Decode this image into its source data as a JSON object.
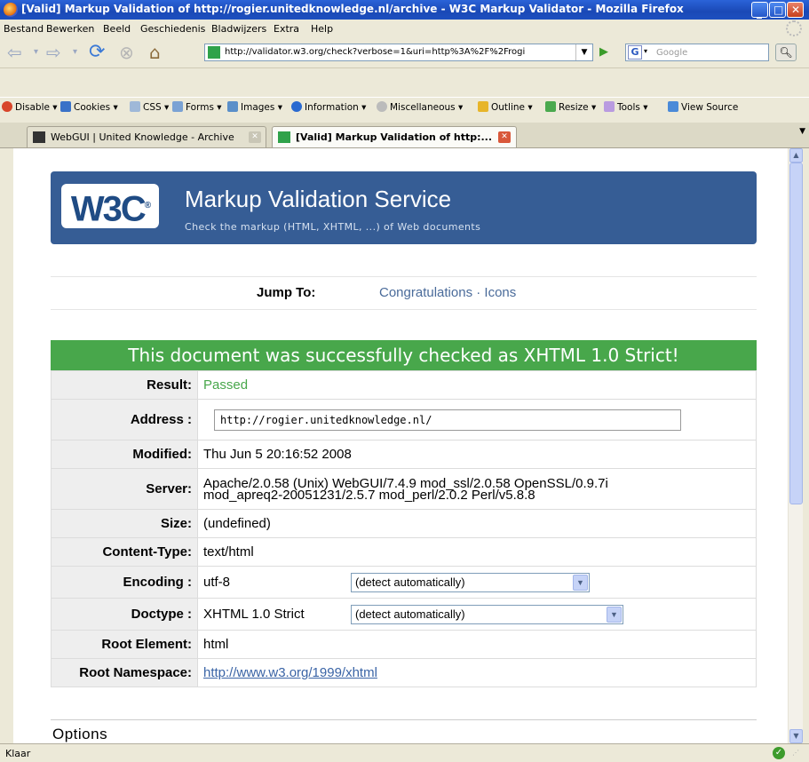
{
  "window": {
    "title": "[Valid] Markup Validation of http://rogier.unitedknowledge.nl/archive - W3C Markup Validator - Mozilla Firefox"
  },
  "menu": [
    "Bestand",
    "Bewerken",
    "Beeld",
    "Geschiedenis",
    "Bladwijzers",
    "Extra",
    "Help"
  ],
  "nav": {
    "url": "http://validator.w3.org/check?verbose=1&uri=http%3A%2F%2Frogi",
    "search_placeholder": "Google",
    "search_engine_glyph": "G"
  },
  "webdev": [
    "Disable",
    "Cookies",
    "CSS",
    "Forms",
    "Images",
    "Information",
    "Miscellaneous",
    "Outline",
    "Resize",
    "Tools",
    "View Source"
  ],
  "tabs": [
    {
      "label": "WebGUI | United Knowledge - Archive"
    },
    {
      "label": "[Valid] Markup Validation of http:..."
    }
  ],
  "page": {
    "logo_text": "W3C",
    "logo_reg": "®",
    "service_title": "Markup Validation Service",
    "service_subtitle": "Check the markup (HTML, XHTML, ...) of Web documents",
    "jump_label": "Jump To:",
    "jump_links": "Congratulations · Icons",
    "success_message": "This document was successfully checked as XHTML 1.0 Strict!",
    "rows": {
      "result": {
        "label": "Result:",
        "value": "Passed"
      },
      "address": {
        "label": "Address :",
        "value": "http://rogier.unitedknowledge.nl/"
      },
      "modified": {
        "label": "Modified:",
        "value": "Thu Jun 5 20:16:52 2008"
      },
      "server": {
        "label": "Server:",
        "value_line1": "Apache/2.0.58 (Unix) WebGUI/7.4.9 mod_ssl/2.0.58 OpenSSL/0.9.7i",
        "value_line2": "mod_apreq2-20051231/2.5.7 mod_perl/2.0.2 Perl/v5.8.8"
      },
      "size": {
        "label": "Size:",
        "value": "(undefined)"
      },
      "content_type": {
        "label": "Content-Type:",
        "value": "text/html"
      },
      "encoding": {
        "label": "Encoding :",
        "value": "utf-8",
        "select": "(detect automatically)"
      },
      "doctype": {
        "label": "Doctype :",
        "value": "XHTML 1.0 Strict",
        "select": "(detect automatically)"
      },
      "root_element": {
        "label": "Root Element:",
        "value": "html"
      },
      "root_namespace": {
        "label": "Root Namespace:",
        "value": "http://www.w3.org/1999/xhtml"
      }
    },
    "options_heading": "Options"
  },
  "status": {
    "text": "Klaar"
  },
  "colors": {
    "banner": "#365d95",
    "success": "#48a74b",
    "link": "#3a64a6"
  }
}
